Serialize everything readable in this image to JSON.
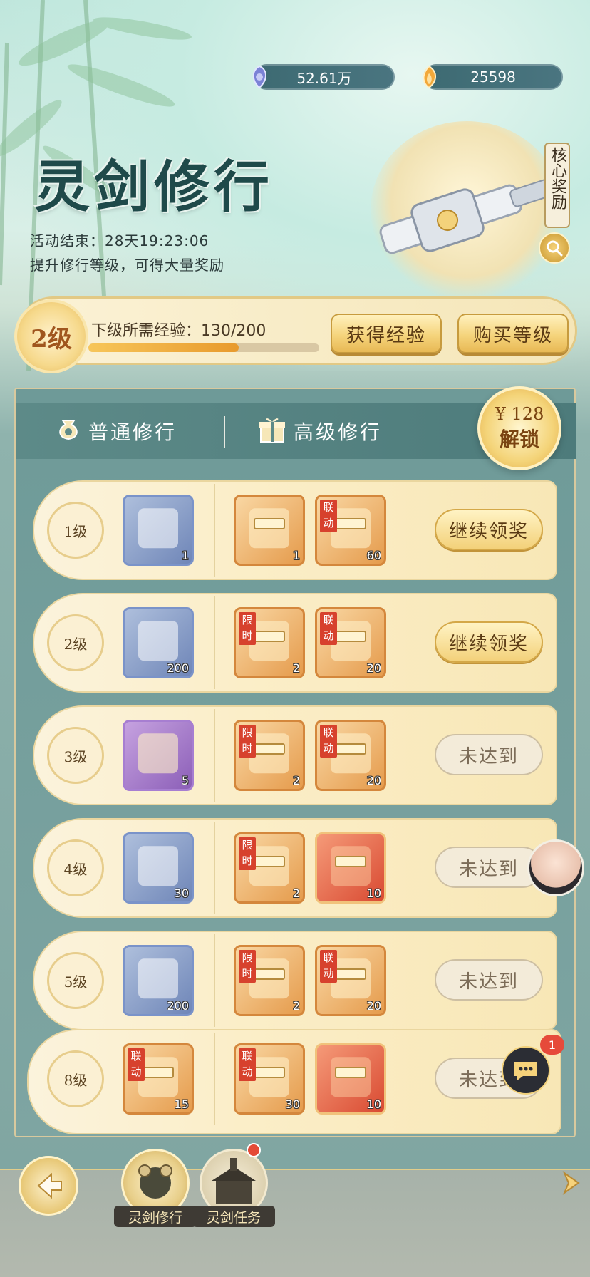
{
  "currencies": [
    {
      "icon": "jade-gem-icon",
      "value": "52.61万"
    },
    {
      "icon": "gold-flame-icon",
      "value": "25598"
    }
  ],
  "header": {
    "title": "灵剑修行",
    "end_label": "活动结束：28天19:23:06",
    "desc": "提升修行等级，可得大量奖励",
    "core_reward_label": "核心奖励"
  },
  "level": {
    "badge": "2级",
    "exp_label": "下级所需经验：130/200",
    "exp_fraction": 0.65,
    "get_exp_label": "获得经验",
    "buy_level_label": "购买等级"
  },
  "tabs": {
    "normal": "普通修行",
    "advanced": "高级修行",
    "unlock_price": "¥ 128",
    "unlock_label": "解锁"
  },
  "rows": [
    {
      "level": "1级",
      "free": {
        "count": "1",
        "color": "blue"
      },
      "premium": [
        {
          "count": "1",
          "color": "orange",
          "tag": ""
        },
        {
          "count": "60",
          "color": "orange",
          "tag": "联动"
        }
      ],
      "action": "继续领奖",
      "state": "claim"
    },
    {
      "level": "2级",
      "free": {
        "count": "200",
        "color": "blue"
      },
      "premium": [
        {
          "count": "2",
          "color": "orange",
          "tag": "限时"
        },
        {
          "count": "20",
          "color": "orange",
          "tag": "联动"
        }
      ],
      "action": "继续领奖",
      "state": "claim"
    },
    {
      "level": "3级",
      "free": {
        "count": "5",
        "color": "purple"
      },
      "premium": [
        {
          "count": "2",
          "color": "orange",
          "tag": "限时"
        },
        {
          "count": "20",
          "color": "orange",
          "tag": "联动"
        }
      ],
      "action": "未达到",
      "state": "locked"
    },
    {
      "level": "4级",
      "free": {
        "count": "30",
        "color": "blue"
      },
      "premium": [
        {
          "count": "2",
          "color": "orange",
          "tag": "限时"
        },
        {
          "count": "10",
          "color": "red",
          "tag": ""
        }
      ],
      "action": "未达到",
      "state": "locked"
    },
    {
      "level": "5级",
      "free": {
        "count": "200",
        "color": "blue"
      },
      "premium": [
        {
          "count": "2",
          "color": "orange",
          "tag": "限时"
        },
        {
          "count": "20",
          "color": "orange",
          "tag": "联动"
        }
      ],
      "action": "未达到",
      "state": "locked"
    },
    {
      "level": "8级",
      "free": {
        "count": "15",
        "color": "orange",
        "tag": "联动"
      },
      "premium": [
        {
          "count": "30",
          "color": "orange",
          "tag": "联动"
        },
        {
          "count": "10",
          "color": "red",
          "tag": ""
        }
      ],
      "action": "未达到",
      "state": "locked"
    }
  ],
  "chat": {
    "badge": "1"
  },
  "bottom_nav": [
    {
      "label": "灵剑修行"
    },
    {
      "label": "灵剑任务"
    }
  ],
  "colors": {
    "accent_gold": "#f5d47c",
    "panel_teal": "#6e9a98",
    "tag_red": "#d7412d"
  }
}
